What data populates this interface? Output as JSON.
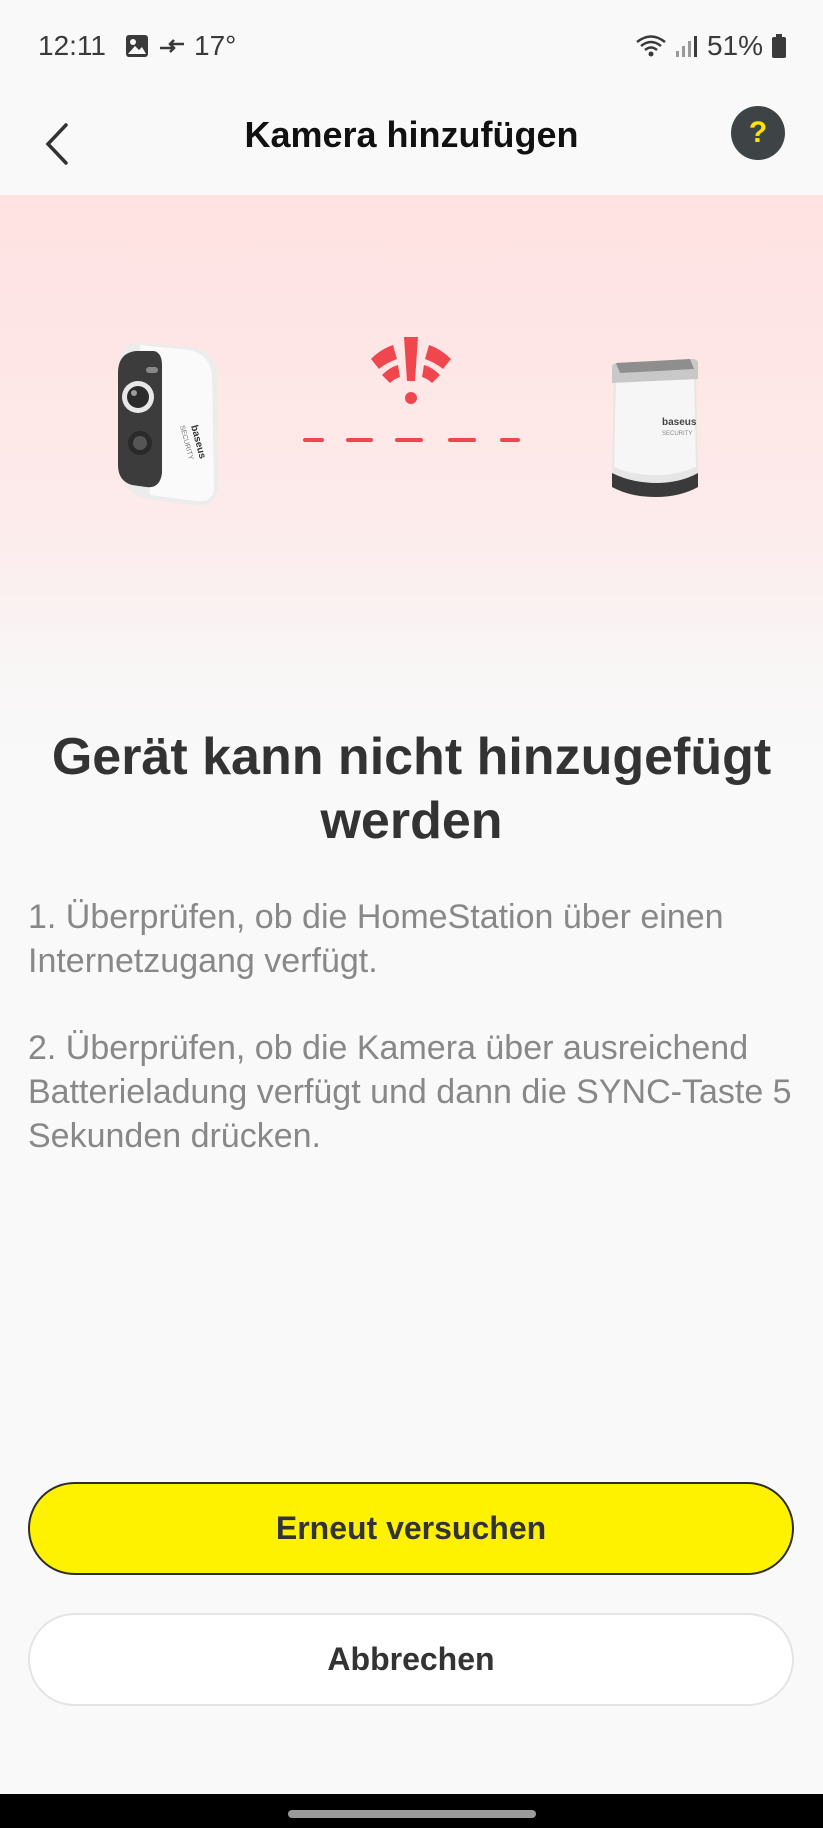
{
  "status_bar": {
    "time": "12:11",
    "temperature": "17°",
    "battery": "51%",
    "icons": [
      "gallery-icon",
      "data-transfer-icon",
      "wifi-icon",
      "signal-icon",
      "battery-icon"
    ]
  },
  "header": {
    "title": "Kamera hinzufügen",
    "help_label": "?",
    "back_icon": "chevron-left-icon"
  },
  "illustration": {
    "left_device_text": [
      "baseus",
      "SECURITY"
    ],
    "right_device_text": [
      "baseus",
      "SECURITY"
    ],
    "error_icon": "wifi-error-icon",
    "error_color": "#f0474f"
  },
  "error": {
    "title": "Gerät kann nicht hinzugefügt werden",
    "step1": "1. Überprüfen, ob die HomeStation über einen Internetzugang verfügt.",
    "step2": "2. Überprüfen, ob die Kamera über ausreichend Batterieladung verfügt und dann die SYNC-Taste 5 Sekunden drücken."
  },
  "buttons": {
    "retry": "Erneut versuchen",
    "cancel": "Abbrechen"
  },
  "colors": {
    "accent": "#fef200",
    "error": "#f0474f",
    "help_button_bg": "#3e4346"
  }
}
